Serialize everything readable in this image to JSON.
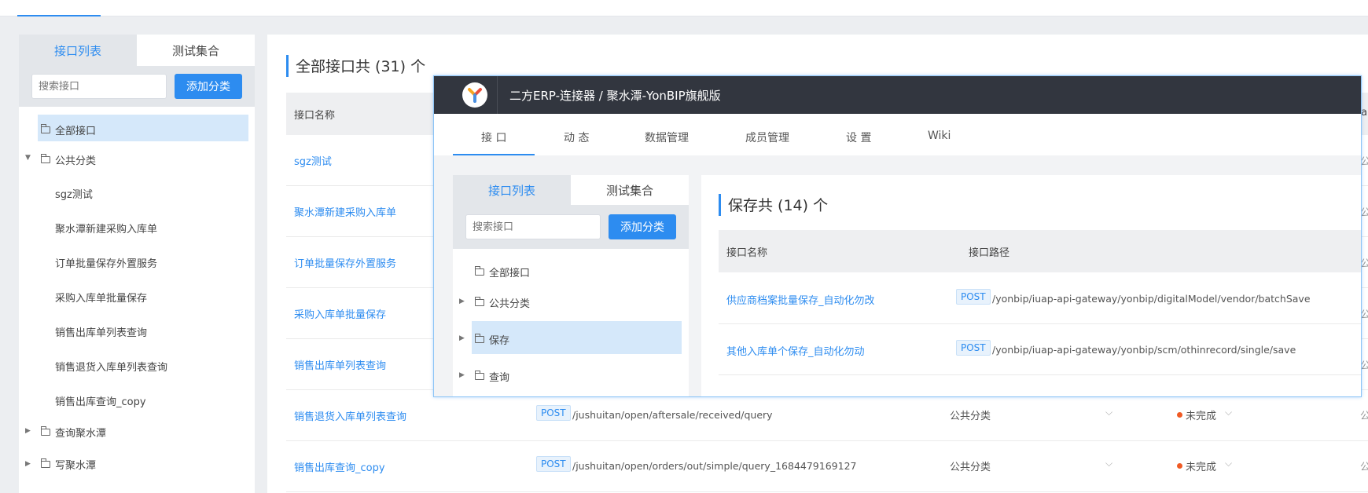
{
  "bg": {
    "left_tabs": [
      "接口列表",
      "测试集合"
    ],
    "search_placeholder": "搜索接口",
    "add_category": "添加分类",
    "tree": {
      "all": "全部接口",
      "public": "公共分类",
      "public_children": [
        "sgz测试",
        "聚水潭新建采购入库单",
        "订单批量保存外置服务",
        "采购入库单批量保存",
        "销售出库单列表查询",
        "销售退货入库单列表查询",
        "销售出库查询_copy"
      ],
      "query": "查询聚水潭",
      "write": "写聚水潭"
    },
    "main_title": "全部接口共 (31) 个",
    "col_name": "接口名称",
    "col_edge": "ta",
    "rows": [
      {
        "name": "sgz测试"
      },
      {
        "name": "聚水潭新建采购入库单"
      },
      {
        "name": "订单批量保存外置服务"
      },
      {
        "name": "采购入库单批量保存"
      },
      {
        "name": "销售出库单列表查询"
      },
      {
        "name": "销售退货入库单列表查询",
        "method": "POST",
        "path": "/jushuitan/open/aftersale/received/query",
        "category": "公共分类",
        "status": "未完成"
      },
      {
        "name": "销售出库查询_copy",
        "method": "POST",
        "path": "/jushuitan/open/orders/out/simple/query_1684479169127",
        "category": "公共分类",
        "status": "未完成"
      }
    ],
    "edge_chars": [
      "公",
      "公",
      "公",
      "公",
      "公",
      "公",
      "公",
      "公"
    ]
  },
  "overlay": {
    "breadcrumb": "二方ERP-连接器 / 聚水潭-YonBIP旗舰版",
    "nav": [
      "接 口",
      "动 态",
      "数据管理",
      "成员管理",
      "设 置",
      "Wiki"
    ],
    "left_tabs": [
      "接口列表",
      "测试集合"
    ],
    "search_placeholder": "搜索接口",
    "add_category": "添加分类",
    "tree": [
      "全部接口",
      "公共分类",
      "保存",
      "查询"
    ],
    "main_title": "保存共 (14) 个",
    "col_name": "接口名称",
    "col_path": "接口路径",
    "rows": [
      {
        "name": "供应商档案批量保存_自动化勿改",
        "method": "POST",
        "path": "/yonbip/iuap-api-gateway/yonbip/digitalModel/vendor/batchSave"
      },
      {
        "name": "其他入库单个保存_自动化勿动",
        "method": "POST",
        "path": "/yonbip/iuap-api-gateway/yonbip/scm/othinrecord/single/save"
      }
    ]
  },
  "colors": {
    "accent": "#2d8cf0",
    "header_dark": "#32363f",
    "status_dot": "#f05a24"
  }
}
